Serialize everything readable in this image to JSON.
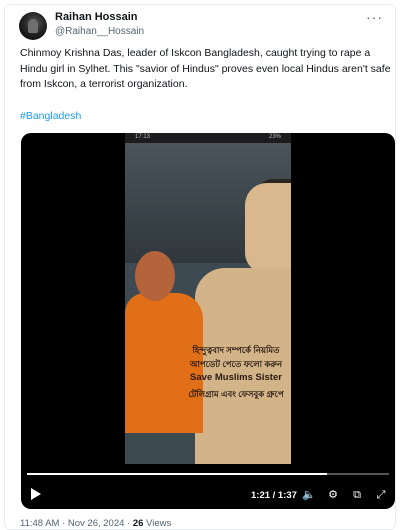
{
  "author": {
    "name": "Raihan Hossain",
    "handle": "@Raihan__Hossain"
  },
  "post": {
    "text": "Chinmoy Krishna Das, leader of Iskcon Bangladesh, caught trying to rape a Hindu girl in Sylhet. This \"savior of Hindus\" proves even local Hindus aren't safe from Iskcon, a terrorist organization.",
    "hashtag": "#Bangladesh"
  },
  "video": {
    "status_time": "17:13",
    "status_right": "23%",
    "overlay_lines": [
      "হিন্দুত্ববাদ সম্পর্কে নিয়মিত",
      "আপডেট পেতে ফলো করুন",
      "Save Muslims Sister",
      "টেলিগ্রাম এবং ফেসবুক গ্রুপে"
    ],
    "time": "1:21 / 1:37",
    "progress": 0.83
  },
  "meta": {
    "time": "11:48 AM · Nov 26, 2024 · ",
    "views_count": "26",
    "views_label": " Views"
  },
  "icons": {
    "more": "more-options-icon",
    "play": "play-icon",
    "volume": "volume-icon",
    "settings": "settings-icon",
    "pip": "picture-in-picture-icon",
    "fullscreen": "fullscreen-icon"
  },
  "colors": {
    "link": "#1d9bf0",
    "text": "#0f1419",
    "muted": "#536471"
  }
}
